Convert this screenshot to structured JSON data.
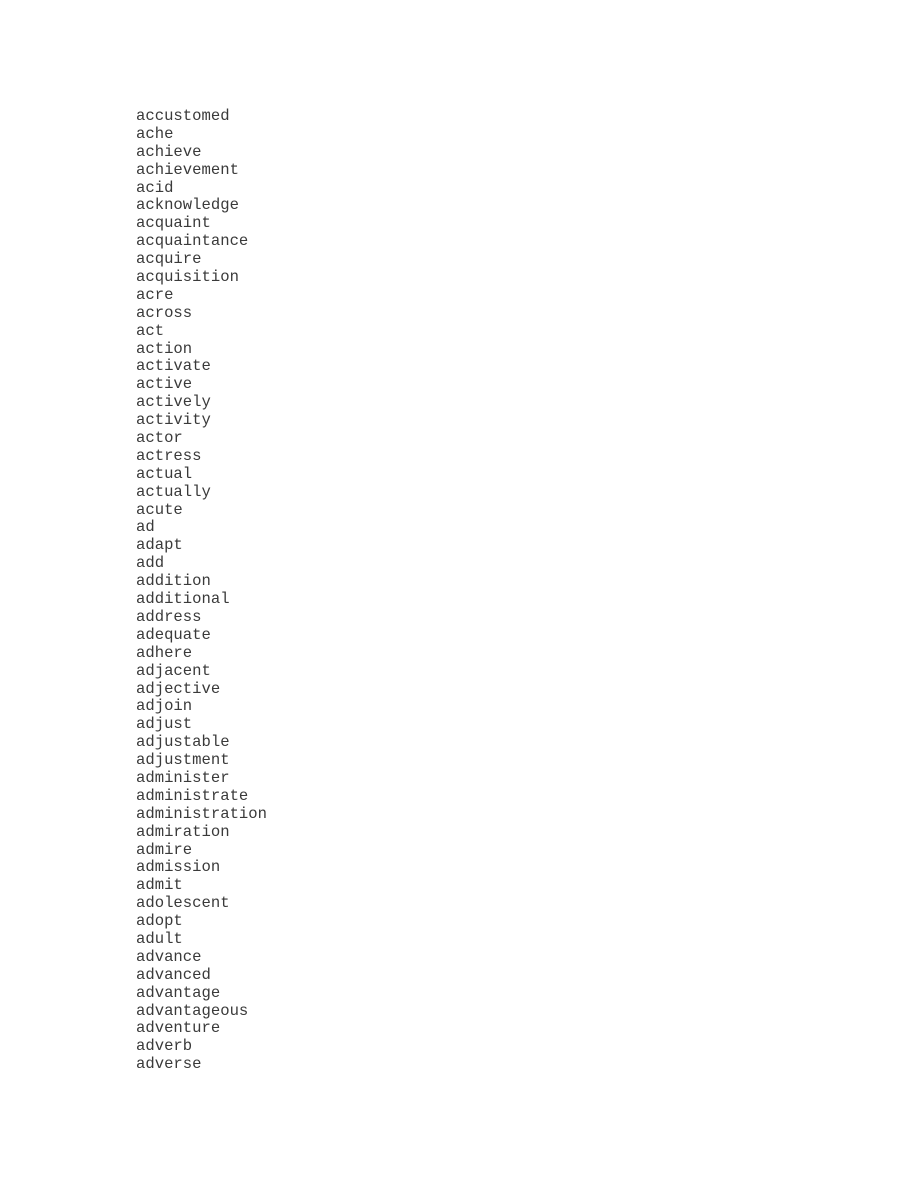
{
  "document": {
    "words": [
      "accustomed",
      "ache",
      "achieve",
      "achievement",
      "acid",
      "acknowledge",
      "acquaint",
      "acquaintance",
      "acquire",
      "acquisition",
      "acre",
      "across",
      "act",
      "action",
      "activate",
      "active",
      "actively",
      "activity",
      "actor",
      "actress",
      "actual",
      "actually",
      "acute",
      "ad",
      "adapt",
      "add",
      "addition",
      "additional",
      "address",
      "adequate",
      "adhere",
      "adjacent",
      "adjective",
      "adjoin",
      "adjust",
      "adjustable",
      "adjustment",
      "administer",
      "administrate",
      "administration",
      "admiration",
      "admire",
      "admission",
      "admit",
      "adolescent",
      "adopt",
      "adult",
      "advance",
      "advanced",
      "advantage",
      "advantageous",
      "adventure",
      "adverb",
      "adverse"
    ]
  }
}
